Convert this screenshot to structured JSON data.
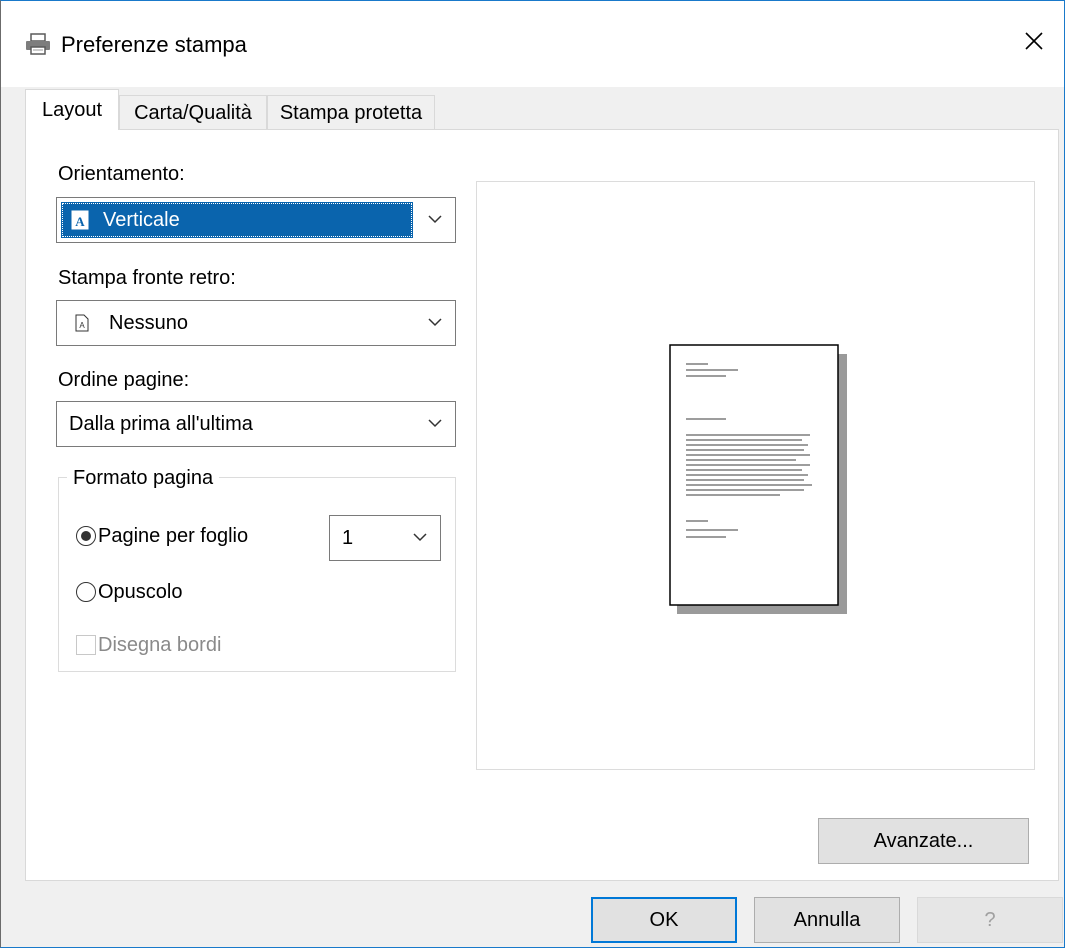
{
  "window": {
    "title": "Preferenze stampa"
  },
  "tabs": [
    {
      "label": "Layout",
      "active": true
    },
    {
      "label": "Carta/Qualità",
      "active": false
    },
    {
      "label": "Stampa protetta",
      "active": false
    }
  ],
  "orientation": {
    "label": "Orientamento:",
    "value": "Verticale",
    "icon": "portrait-page-icon"
  },
  "duplex": {
    "label": "Stampa fronte retro:",
    "value": "Nessuno",
    "icon": "single-page-icon"
  },
  "page_order": {
    "label": "Ordine pagine:",
    "value": "Dalla prima all'ultima"
  },
  "page_format": {
    "group_label": "Formato pagina",
    "pages_per_sheet": {
      "label": "Pagine per foglio",
      "checked": true,
      "value": "1"
    },
    "booklet": {
      "label": "Opuscolo",
      "checked": false
    },
    "draw_borders": {
      "label": "Disegna bordi",
      "checked": false,
      "enabled": false
    }
  },
  "buttons": {
    "advanced": "Avanzate...",
    "ok": "OK",
    "cancel": "Annulla",
    "help": "?"
  },
  "colors": {
    "accent": "#0a64ad",
    "focus": "#0078d7"
  }
}
